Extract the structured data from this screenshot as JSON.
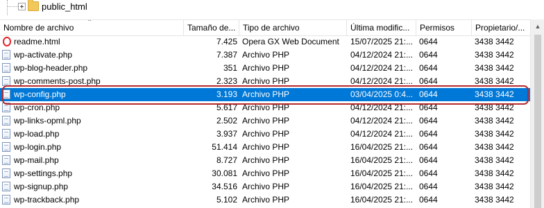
{
  "tree": {
    "folder_label": "public_html"
  },
  "columns": {
    "name": "Nombre de archivo",
    "size": "Tamaño de...",
    "type": "Tipo de archivo",
    "modified": "Última modific...",
    "perms": "Permisos",
    "owner": "Propietario/..."
  },
  "files": [
    {
      "name": "readme.html",
      "size": "7.425",
      "type": "Opera GX Web Document",
      "date": "15/07/2025 21:...",
      "perm": "0644",
      "owner": "3438 3442",
      "icon": "opera-icon"
    },
    {
      "name": "wp-activate.php",
      "size": "7.387",
      "type": "Archivo PHP",
      "date": "04/12/2024 21:...",
      "perm": "0644",
      "owner": "3438 3442",
      "icon": "php-file-icon"
    },
    {
      "name": "wp-blog-header.php",
      "size": "351",
      "type": "Archivo PHP",
      "date": "04/12/2024 21:...",
      "perm": "0644",
      "owner": "3438 3442",
      "icon": "php-file-icon"
    },
    {
      "name": "wp-comments-post.php",
      "size": "2.323",
      "type": "Archivo PHP",
      "date": "04/12/2024 21:...",
      "perm": "0644",
      "owner": "3438 3442",
      "icon": "php-file-icon"
    },
    {
      "name": "wp-config.php",
      "size": "3.193",
      "type": "Archivo PHP",
      "date": "03/04/2025 0:4...",
      "perm": "0644",
      "owner": "3438 3442",
      "icon": "php-file-icon",
      "selected": true
    },
    {
      "name": "wp-cron.php",
      "size": "5.617",
      "type": "Archivo PHP",
      "date": "04/12/2024 21:...",
      "perm": "0644",
      "owner": "3438 3442",
      "icon": "php-file-icon"
    },
    {
      "name": "wp-links-opml.php",
      "size": "2.502",
      "type": "Archivo PHP",
      "date": "04/12/2024 21:...",
      "perm": "0644",
      "owner": "3438 3442",
      "icon": "php-file-icon"
    },
    {
      "name": "wp-load.php",
      "size": "3.937",
      "type": "Archivo PHP",
      "date": "04/12/2024 21:...",
      "perm": "0644",
      "owner": "3438 3442",
      "icon": "php-file-icon"
    },
    {
      "name": "wp-login.php",
      "size": "51.414",
      "type": "Archivo PHP",
      "date": "16/04/2025 21:...",
      "perm": "0644",
      "owner": "3438 3442",
      "icon": "php-file-icon"
    },
    {
      "name": "wp-mail.php",
      "size": "8.727",
      "type": "Archivo PHP",
      "date": "16/04/2025 21:...",
      "perm": "0644",
      "owner": "3438 3442",
      "icon": "php-file-icon"
    },
    {
      "name": "wp-settings.php",
      "size": "30.081",
      "type": "Archivo PHP",
      "date": "16/04/2025 21:...",
      "perm": "0644",
      "owner": "3438 3442",
      "icon": "php-file-icon"
    },
    {
      "name": "wp-signup.php",
      "size": "34.516",
      "type": "Archivo PHP",
      "date": "16/04/2025 21:...",
      "perm": "0644",
      "owner": "3438 3442",
      "icon": "php-file-icon"
    },
    {
      "name": "wp-trackback.php",
      "size": "5.102",
      "type": "Archivo PHP",
      "date": "16/04/2025 21:...",
      "perm": "0644",
      "owner": "3438 3442",
      "icon": "php-file-icon"
    }
  ]
}
